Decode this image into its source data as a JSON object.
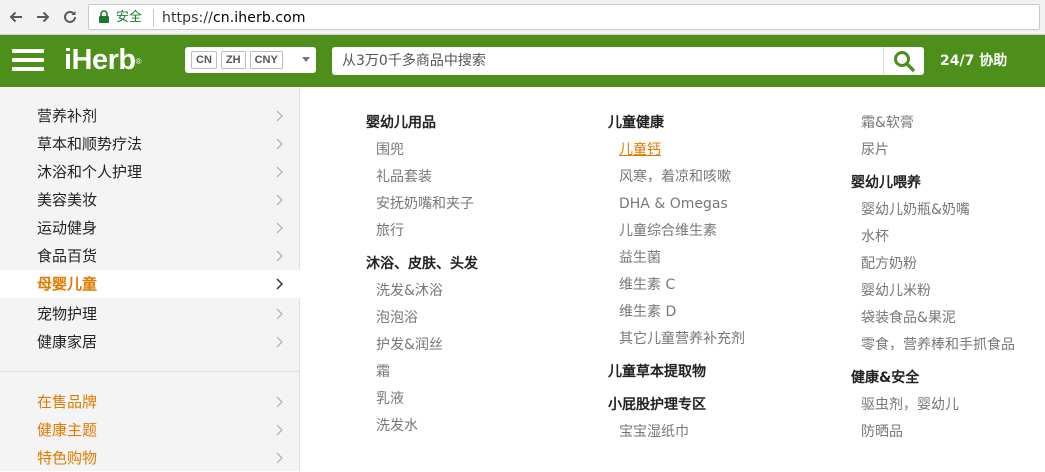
{
  "browser": {
    "secure_label": "安全",
    "url_scheme": "https://",
    "url_domain": "cn.iherb.com"
  },
  "header": {
    "logo": "iHerb",
    "logo_mark": "®",
    "locale": [
      "CN",
      "ZH",
      "CNY"
    ],
    "search_placeholder": "从3万0千多商品中搜索",
    "help": "24/7 协助",
    "brand_color": "#4d8f1a"
  },
  "left_menu": {
    "items": [
      {
        "label": "营养补剂"
      },
      {
        "label": "草本和顺势疗法"
      },
      {
        "label": "沐浴和个人护理"
      },
      {
        "label": "美容美妆"
      },
      {
        "label": "运动健身"
      },
      {
        "label": "食品百货"
      },
      {
        "label": "母婴儿童",
        "active": true
      },
      {
        "label": "宠物护理"
      },
      {
        "label": "健康家居"
      }
    ],
    "promo_items": [
      {
        "label": "在售品牌"
      },
      {
        "label": "健康主题"
      },
      {
        "label": "特色购物"
      }
    ],
    "accent_color": "#e07b00"
  },
  "mega_menu": {
    "columns": [
      {
        "groups": [
          {
            "heading": "婴幼儿用品",
            "items": [
              "围兜",
              "礼品套装",
              "安抚奶嘴和夹子",
              "旅行"
            ]
          },
          {
            "heading": "沐浴、皮肤、头发",
            "items": [
              "洗发&沐浴",
              "泡泡浴",
              "护发&润丝",
              "霜",
              "乳液",
              "洗发水"
            ]
          }
        ]
      },
      {
        "groups": [
          {
            "heading": "儿童健康",
            "items": [
              "儿童钙",
              "风寒，着凉和咳嗽",
              "DHA & Omegas",
              "儿童综合维生素",
              "益生菌",
              "维生素 C",
              "维生素 D",
              "其它儿童营养补充剂"
            ]
          },
          {
            "heading": "儿童草本提取物",
            "items": []
          },
          {
            "heading": "小屁股护理专区",
            "items": [
              "宝宝湿纸巾"
            ]
          }
        ]
      },
      {
        "groups": [
          {
            "heading": "",
            "items": [
              "霜&软膏",
              "尿片"
            ]
          },
          {
            "heading": "婴幼儿喂养",
            "items": [
              "婴幼儿奶瓶&奶嘴",
              "水杯",
              "配方奶粉",
              "婴幼儿米粉",
              "袋装食品&果泥",
              "零食，营养棒和手抓食品"
            ]
          },
          {
            "heading": "健康&安全",
            "items": [
              "驱虫剂，婴幼儿",
              "防晒品"
            ]
          }
        ]
      }
    ],
    "highlighted_item": "儿童钙"
  }
}
